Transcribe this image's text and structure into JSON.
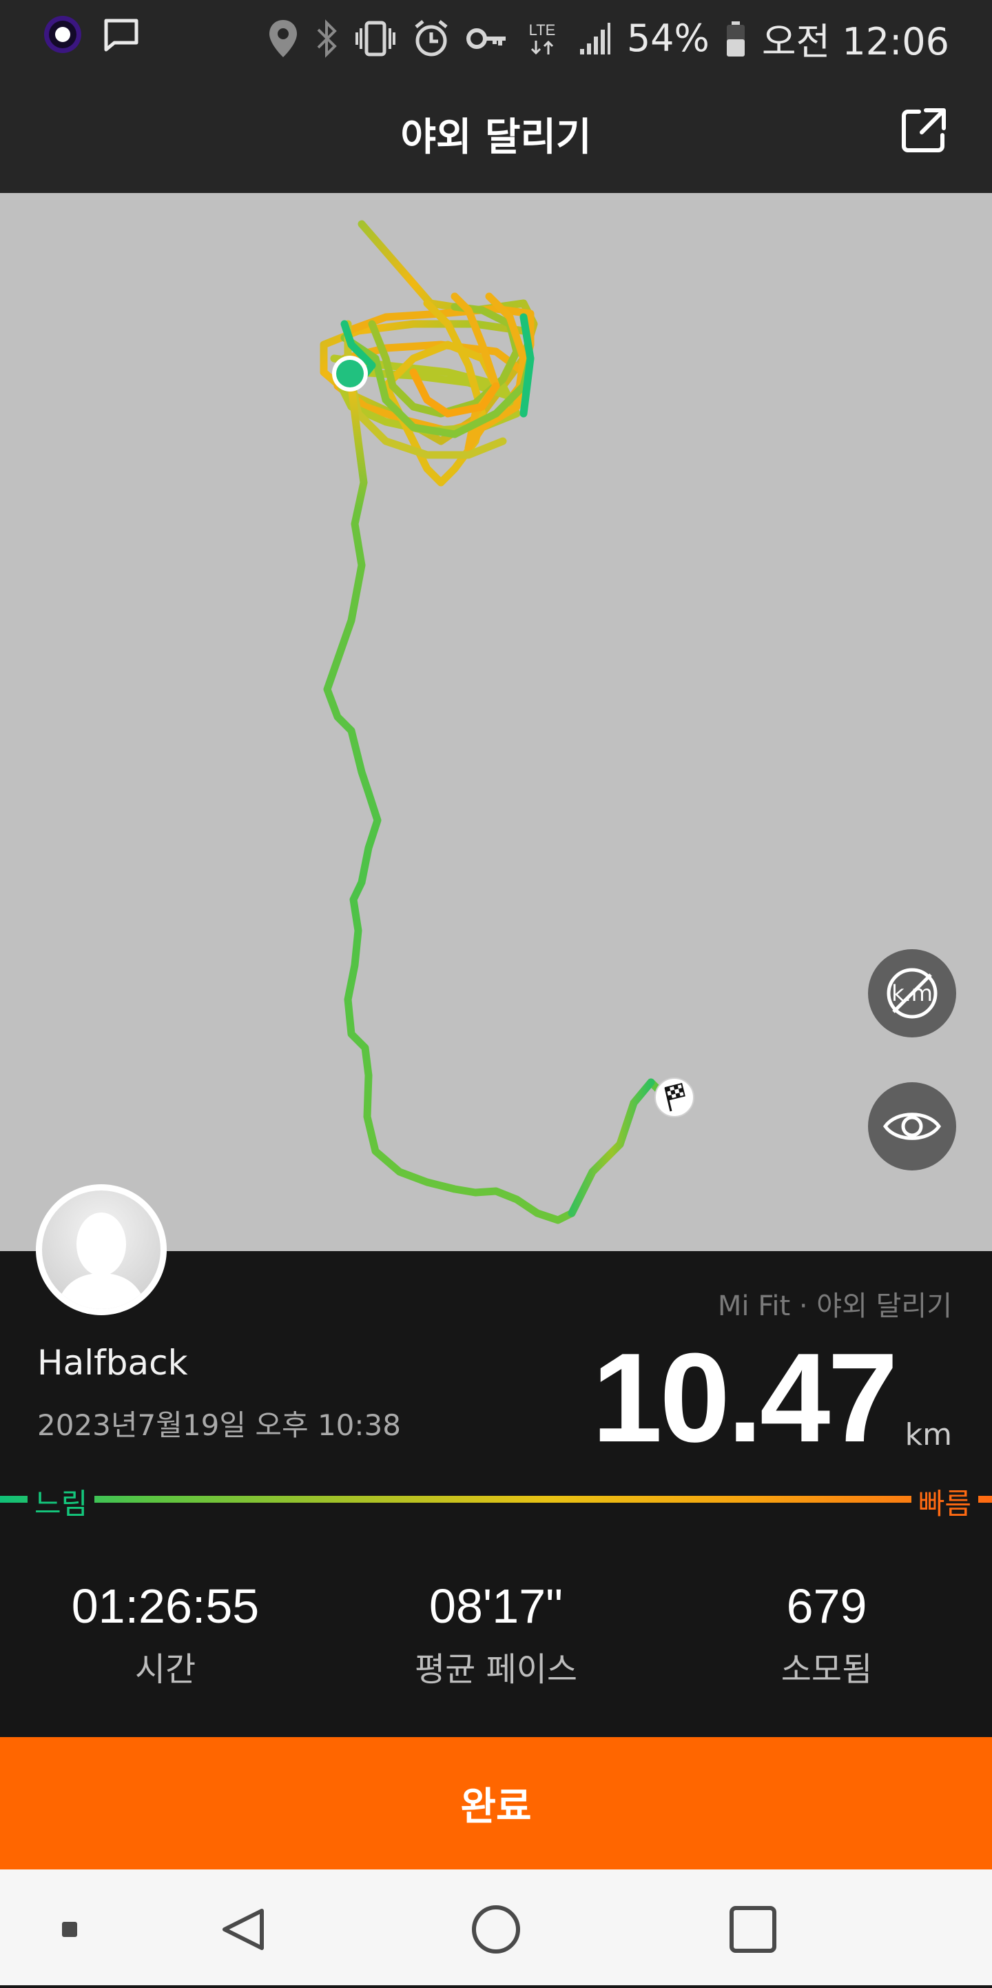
{
  "status_bar": {
    "battery": "54%",
    "time": "오전 12:06",
    "network": "LTE",
    "icons": [
      "app-notification-icon",
      "message-icon",
      "location-icon",
      "bluetooth-icon",
      "vibrate-icon",
      "alarm-icon",
      "vpn-key-icon",
      "lte-icon",
      "signal-icon",
      "battery-icon"
    ]
  },
  "header": {
    "title": "야외 달리기",
    "share_icon": "share-icon"
  },
  "map": {
    "buttons": [
      "km-markers-toggle-icon",
      "eye-icon"
    ],
    "start_marker": "start-icon",
    "finish_marker": "checkered-flag-icon"
  },
  "workout": {
    "source": "Mi Fit · 야외 달리기",
    "user_name": "Halfback",
    "date": "2023년7월19일 오후 10:38",
    "distance_value": "10.47",
    "distance_unit": "km"
  },
  "pace_legend": {
    "slow_label": "느림",
    "fast_label": "빠름",
    "slow_color": "#14c77c",
    "fast_color": "#ff6a12"
  },
  "stats": [
    {
      "value": "01:26:55",
      "label": "시간"
    },
    {
      "value": "08'17\"",
      "label": "평균 페이스"
    },
    {
      "value": "679",
      "label": "소모됨"
    }
  ],
  "actions": {
    "done_label": "완료",
    "done_color": "#ff6600"
  },
  "navigation": {
    "icons": [
      "recent-square-icon",
      "back-icon",
      "home-icon",
      "overview-icon"
    ]
  }
}
